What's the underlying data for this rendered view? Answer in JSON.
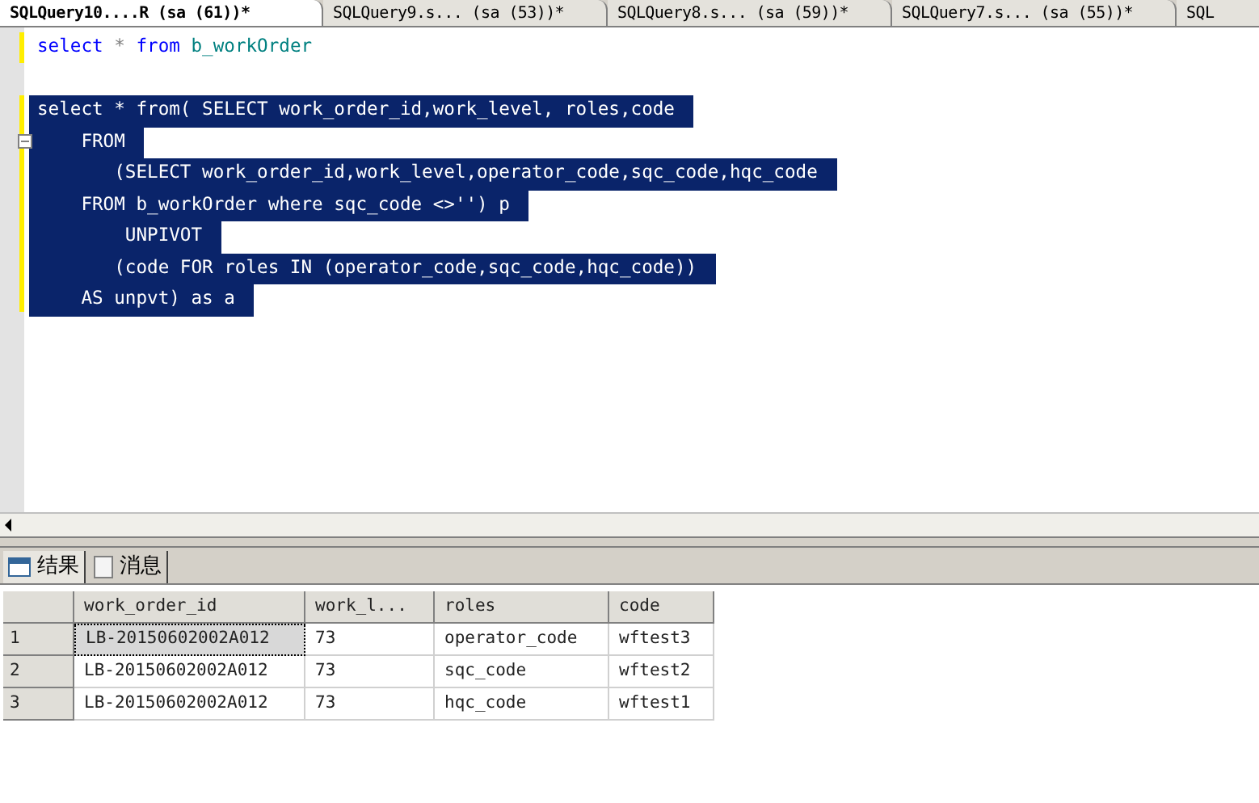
{
  "tabs": [
    {
      "label": "SQLQuery10....R (sa (61))*",
      "selected": true
    },
    {
      "label": "SQLQuery9.s... (sa (53))*",
      "selected": false
    },
    {
      "label": "SQLQuery8.s... (sa (59))*",
      "selected": false
    },
    {
      "label": "SQLQuery7.s... (sa (55))*",
      "selected": false
    },
    {
      "label": "SQL",
      "selected": false
    }
  ],
  "editor": {
    "statements": [
      {
        "lines": [
          {
            "selected": false,
            "tokens": [
              {
                "text": "select",
                "kind": "keyword"
              },
              {
                "text": " * ",
                "kind": "operator"
              },
              {
                "text": "from",
                "kind": "keyword"
              },
              {
                "text": " b_workOrder",
                "kind": "identifier"
              }
            ]
          }
        ]
      },
      {
        "lines": [
          {
            "selected": true,
            "tokens": [
              {
                "text": "select * from( SELECT work_order_id,work_level, roles,code",
                "kind": "plain"
              }
            ]
          },
          {
            "selected": true,
            "tokens": [
              {
                "text": "    FROM",
                "kind": "plain"
              }
            ]
          },
          {
            "selected": true,
            "tokens": [
              {
                "text": "       (SELECT work_order_id,work_level,operator_code,sqc_code,hqc_code",
                "kind": "plain"
              }
            ]
          },
          {
            "selected": true,
            "tokens": [
              {
                "text": "    FROM b_workOrder where sqc_code <>'') p",
                "kind": "plain"
              }
            ]
          },
          {
            "selected": true,
            "tokens": [
              {
                "text": "        UNPIVOT",
                "kind": "plain"
              }
            ]
          },
          {
            "selected": true,
            "tokens": [
              {
                "text": "       (code FOR roles IN (operator_code,sqc_code,hqc_code))",
                "kind": "plain"
              }
            ]
          },
          {
            "selected": true,
            "tokens": [
              {
                "text": "    AS unpvt) as a",
                "kind": "plain"
              }
            ]
          }
        ]
      }
    ]
  },
  "result_tabs": [
    {
      "label": "结果",
      "selected": true,
      "kind": "grid"
    },
    {
      "label": "消息",
      "selected": false,
      "kind": "messages"
    }
  ],
  "table": {
    "columns": [
      "work_order_id",
      "work_l...",
      "roles",
      "code"
    ],
    "rows": [
      {
        "number": "1",
        "cells": [
          "LB-20150602002A012",
          "73",
          "operator_code",
          "wftest3"
        ]
      },
      {
        "number": "2",
        "cells": [
          "LB-20150602002A012",
          "73",
          "sqc_code",
          "wftest2"
        ]
      },
      {
        "number": "3",
        "cells": [
          "LB-20150602002A012",
          "73",
          "hqc_code",
          "wftest1"
        ]
      }
    ]
  }
}
